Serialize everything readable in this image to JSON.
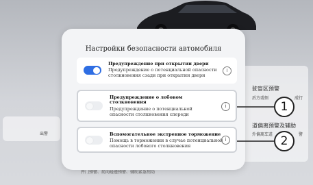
{
  "dialog": {
    "title": "Настройки безопасности автомобиля",
    "items": [
      {
        "title": "Предупреждение при открытии двери",
        "description": "Предупреждение о потенциальной опасности столкновения сзади при открытии двери",
        "enabled": true
      },
      {
        "title": "Предупреждение о лобовом столкновения",
        "description": "Предупреждение о потенциальной опасности столкновения спереди",
        "enabled": false
      },
      {
        "title": "Вспомогательное экстренное торможение",
        "description": "Помощь в торможении в случае потенциальной опасности лобового столкновения",
        "enabled": false
      }
    ],
    "info_glyph": "i"
  },
  "callouts": [
    "1",
    "2"
  ],
  "background": {
    "right_line1": "驶盲区预警",
    "right_line2": "后方或侧",
    "right_line3": "成行",
    "right_line4": "道偏离预警及辅助",
    "right_line5": "外偏离车道",
    "right_line6": "警",
    "left_line": "出警",
    "bottom_line": "开门预警、前向碰撞预警、辅助紧急制动"
  },
  "colors": {
    "accent": "#2f6ee3"
  }
}
